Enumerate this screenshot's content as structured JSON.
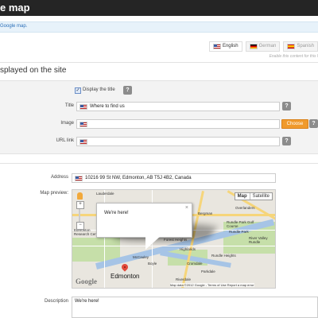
{
  "header": {
    "title": "e map"
  },
  "info": {
    "link_text": "Google map."
  },
  "languages": [
    {
      "label": "English",
      "flag": "us",
      "active": true
    },
    {
      "label": "German",
      "flag": "de",
      "active": false
    },
    {
      "label": "Spanish",
      "flag": "es",
      "active": false
    }
  ],
  "enable_note": "Enable this content for this l",
  "section": {
    "title": "splayed on the site"
  },
  "form": {
    "display_title_label": "Display the title",
    "display_title_checked": true,
    "help_glyph": "?",
    "title_label": "Title",
    "title_value": "Where to find us",
    "image_label": "Image",
    "image_value": "",
    "choose_label": "Choose",
    "url_label": "URL link",
    "url_value": "",
    "address_label": "Address",
    "address_value": "10216 99 St NW, Edmonton, AB T5J 4B2, Canada",
    "map_preview_label": "Map preview:",
    "description_label": "Description",
    "description_value": "We're here!"
  },
  "map": {
    "type_map": "Map",
    "type_satellite": "Satellite",
    "bubble_text": "We're here!",
    "bubble_close": "×",
    "city_label": "Edmonton",
    "google_logo": "Google",
    "footer": "Map data ©2012 Google - Terms of Use   Report a map error",
    "labels": [
      "Lauderdale",
      "Bergman",
      "Overlanders",
      "Edmonton Research Centre",
      "Rundle Park Golf Course",
      "Rundle Park",
      "River Valley Rundle",
      "McCauley",
      "Highlands",
      "Rundle Heights",
      "Boyle",
      "Cromdale",
      "Parkdale",
      "Riverdale",
      "Forest Heights"
    ],
    "colors": {
      "water": "#a6c4e6",
      "park": "#c6dfa9",
      "road": "#f6d57a",
      "marker": "#e24a3b"
    }
  },
  "colors": {
    "topbar": "#252525",
    "accent_button": "#f09a2c",
    "info_bg": "#e7f2fa"
  }
}
